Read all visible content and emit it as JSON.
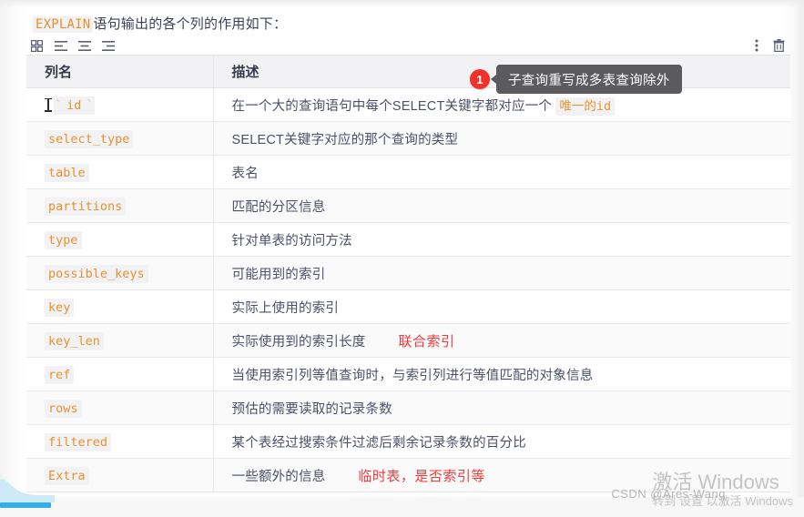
{
  "intro": {
    "code": "EXPLAIN",
    "text": "语句输出的各个列的作用如下："
  },
  "toolbar": {
    "left_icons": [
      {
        "name": "table-grid-icon",
        "label": "表格布局"
      },
      {
        "name": "align-left-icon",
        "label": "左对齐"
      },
      {
        "name": "align-center-icon",
        "label": "居中对齐"
      },
      {
        "name": "align-right-icon",
        "label": "右对齐"
      }
    ],
    "right_icons": [
      {
        "name": "more-vertical-icon",
        "label": "更多"
      },
      {
        "name": "trash-icon",
        "label": "删除"
      }
    ]
  },
  "table": {
    "headers": [
      "列名",
      "描述"
    ],
    "rows": [
      {
        "name": "id",
        "desc_prefix": "在一个大的查询语句中每个SELECT关键字都对应一个 ",
        "desc_code": "唯一的id",
        "desc_suffix": "",
        "annotation": "",
        "caret": true,
        "ticks": true
      },
      {
        "name": "select_type",
        "desc_prefix": "SELECT关键字对应的那个查询的类型",
        "desc_code": "",
        "desc_suffix": "",
        "annotation": "",
        "caret": false,
        "ticks": false
      },
      {
        "name": "table",
        "desc_prefix": "表名",
        "desc_code": "",
        "desc_suffix": "",
        "annotation": "",
        "caret": false,
        "ticks": false
      },
      {
        "name": "partitions",
        "desc_prefix": "匹配的分区信息",
        "desc_code": "",
        "desc_suffix": "",
        "annotation": "",
        "caret": false,
        "ticks": false
      },
      {
        "name": "type",
        "desc_prefix": "针对单表的访问方法",
        "desc_code": "",
        "desc_suffix": "",
        "annotation": "",
        "caret": false,
        "ticks": false
      },
      {
        "name": "possible_keys",
        "desc_prefix": "可能用到的索引",
        "desc_code": "",
        "desc_suffix": "",
        "annotation": "",
        "caret": false,
        "ticks": false
      },
      {
        "name": "key",
        "desc_prefix": "实际上使用的索引",
        "desc_code": "",
        "desc_suffix": "",
        "annotation": "",
        "caret": false,
        "ticks": false
      },
      {
        "name": "key_len",
        "desc_prefix": "实际使用到的索引长度",
        "desc_code": "",
        "desc_suffix": "",
        "annotation": "联合索引",
        "caret": false,
        "ticks": false
      },
      {
        "name": "ref",
        "desc_prefix": "当使用索引列等值查询时，与索引列进行等值匹配的对象信息",
        "desc_code": "",
        "desc_suffix": "",
        "annotation": "",
        "caret": false,
        "ticks": false
      },
      {
        "name": "rows",
        "desc_prefix": "预估的需要读取的记录条数",
        "desc_code": "",
        "desc_suffix": "",
        "annotation": "",
        "caret": false,
        "ticks": false
      },
      {
        "name": "filtered",
        "desc_prefix": "某个表经过搜索条件过滤后剩余记录条数的百分比",
        "desc_code": "",
        "desc_suffix": "",
        "annotation": "",
        "caret": false,
        "ticks": false
      },
      {
        "name": "Extra",
        "desc_prefix": "一些额外的信息",
        "desc_code": "",
        "desc_suffix": "",
        "annotation": "临时表，是否索引等",
        "caret": false,
        "ticks": false
      }
    ]
  },
  "tooltip": {
    "badge": "1",
    "text": "子查询重写成多表查询除外"
  },
  "watermarks": {
    "windows_title": "激活 Windows",
    "windows_sub": "转到 设置 以激活 Windows",
    "csdn": "CSDN @Ares-Wang"
  },
  "colors": {
    "code_orange": "#e8912d",
    "annotation_red": "#f23a3a",
    "badge_red": "#f0322b",
    "tooltip_gray": "#5b5b5f",
    "scrollbar_blue": "#35afe3",
    "header_bg": "#f2f2f4"
  }
}
